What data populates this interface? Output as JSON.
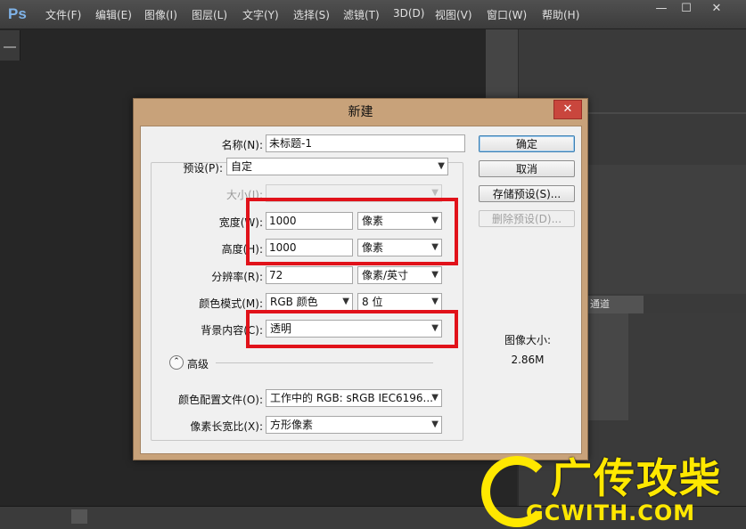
{
  "app": {
    "logo": "Ps",
    "menus": [
      "文件(F)",
      "编辑(E)",
      "图像(I)",
      "图层(L)",
      "文字(Y)",
      "选择(S)",
      "滤镜(T)",
      "3D(D)",
      "视图(V)",
      "窗口(W)",
      "帮助(H)"
    ],
    "panel_tab": "通道"
  },
  "dialog": {
    "title": "新建",
    "close": "✕",
    "name_label": "名称(N):",
    "name_value": "未标题-1",
    "preset_label": "预设(P):",
    "preset_value": "自定",
    "size_label": "大小(I):",
    "size_value": "",
    "width_label": "宽度(W):",
    "width_value": "1000",
    "width_unit": "像素",
    "height_label": "高度(H):",
    "height_value": "1000",
    "height_unit": "像素",
    "resolution_label": "分辨率(R):",
    "resolution_value": "72",
    "resolution_unit": "像素/英寸",
    "color_mode_label": "颜色模式(M):",
    "color_mode_value": "RGB 颜色",
    "bit_depth_value": "8 位",
    "background_label": "背景内容(C):",
    "background_value": "透明",
    "advanced_label": "高级",
    "color_profile_label": "颜色配置文件(O):",
    "color_profile_value": "工作中的 RGB: sRGB IEC6196...",
    "pixel_aspect_label": "像素长宽比(X):",
    "pixel_aspect_value": "方形像素",
    "buttons": {
      "ok": "确定",
      "cancel": "取消",
      "save_preset": "存储预设(S)...",
      "delete_preset": "删除预设(D)..."
    },
    "image_size_label": "图像大小:",
    "image_size_value": "2.86M"
  },
  "watermark": {
    "text": "广传攻柴",
    "url": "GCWITH.COM"
  },
  "colors": {
    "highlight": "#e1121a",
    "dialog_frame": "#c8a27a",
    "watermark": "#ffe800"
  }
}
